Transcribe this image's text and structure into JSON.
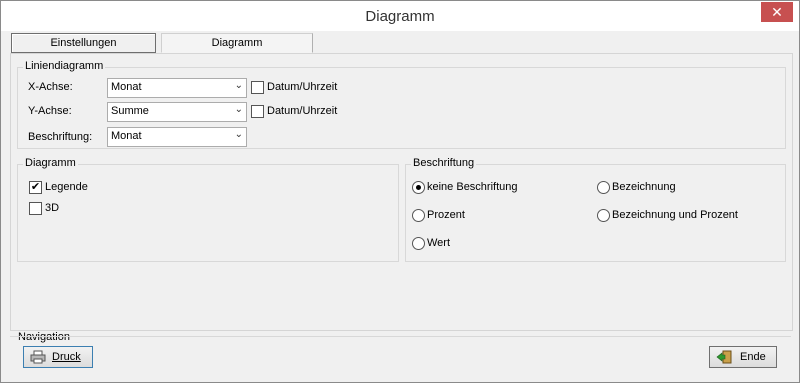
{
  "window": {
    "title": "Diagramm",
    "close_glyph": "✕"
  },
  "tabs": [
    {
      "label": "Einstellungen"
    },
    {
      "label": "Diagramm"
    }
  ],
  "liniendiagramm": {
    "group_label": "Liniendiagramm",
    "x_axis": {
      "label": "X-Achse:",
      "value": "Monat",
      "checkbox_label": "Datum/Uhrzeit",
      "checked": false
    },
    "y_axis": {
      "label": "Y-Achse:",
      "value": "Summe",
      "checkbox_label": "Datum/Uhrzeit",
      "checked": false
    },
    "beschriftung": {
      "label": "Beschriftung:",
      "value": "Monat"
    }
  },
  "diagramm": {
    "group_label": "Diagramm",
    "legende": {
      "label": "Legende",
      "checked": true
    },
    "three_d": {
      "label": "3D",
      "checked": false
    }
  },
  "beschriftung": {
    "group_label": "Beschriftung",
    "options": [
      {
        "label": "keine Beschriftung",
        "selected": true
      },
      {
        "label": "Bezeichnung",
        "selected": false
      },
      {
        "label": "Prozent",
        "selected": false
      },
      {
        "label": "Bezeichnung und Prozent",
        "selected": false
      },
      {
        "label": "Wert",
        "selected": false
      }
    ]
  },
  "navigation": {
    "label": "Navigation",
    "druck_button": "Druck",
    "ende_button": "Ende",
    "druck_icon": "printer-icon",
    "ende_icon": "exit-door-icon"
  }
}
